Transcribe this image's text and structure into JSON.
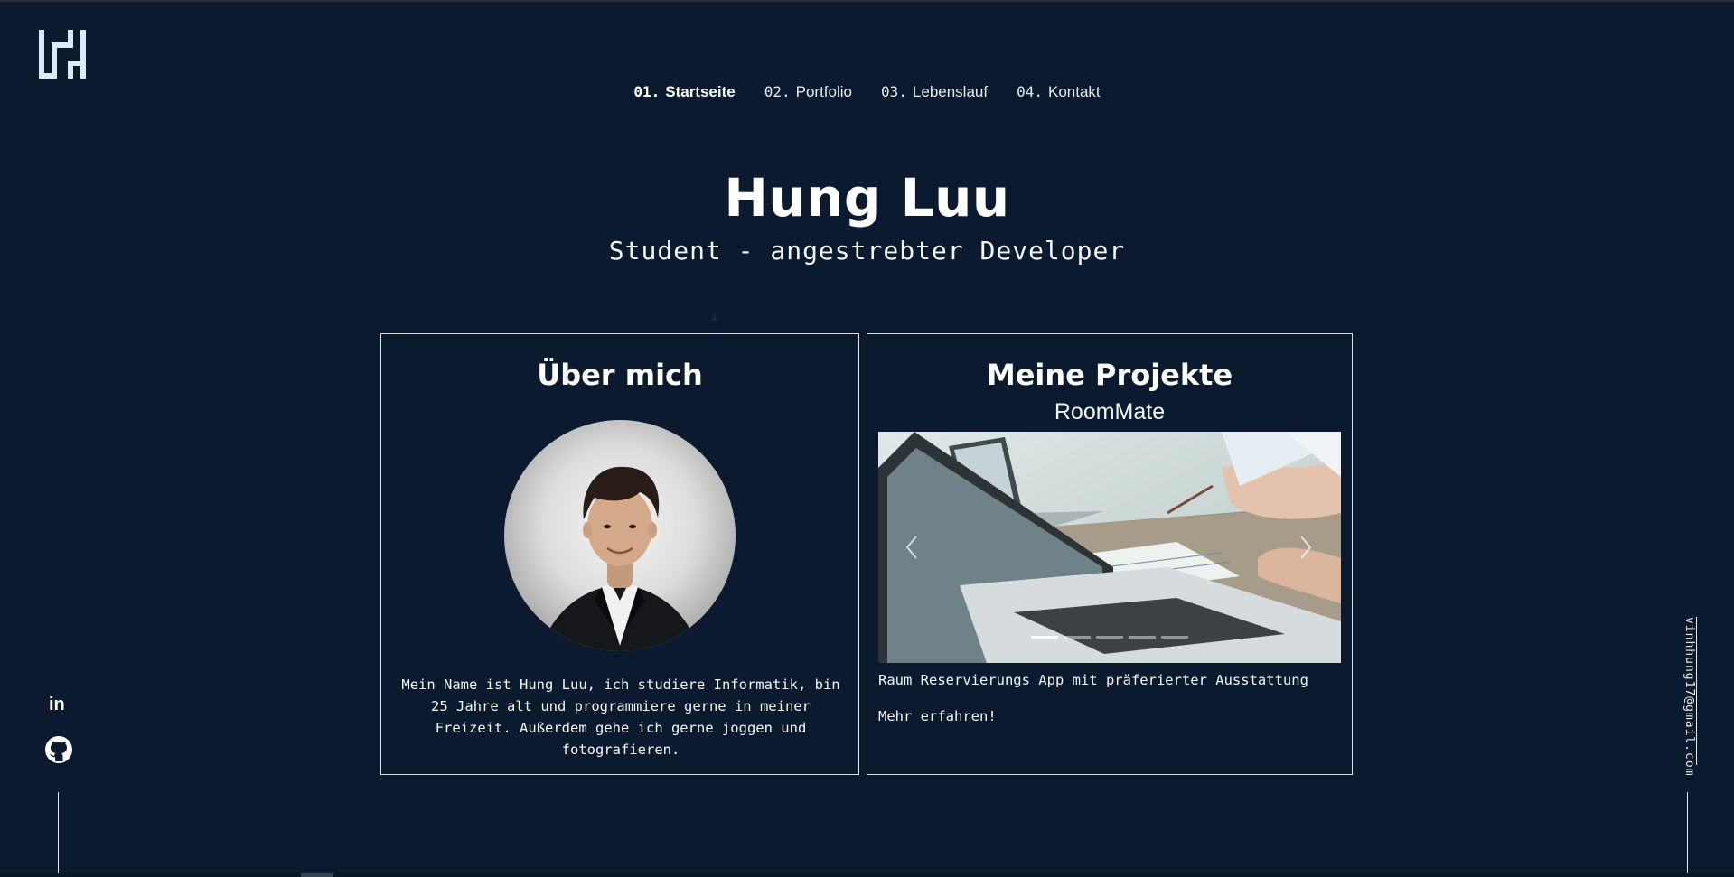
{
  "nav": {
    "items": [
      {
        "num": "01.",
        "label": "Startseite",
        "active": true
      },
      {
        "num": "02.",
        "label": "Portfolio"
      },
      {
        "num": "03.",
        "label": "Lebenslauf"
      },
      {
        "num": "04.",
        "label": "Kontakt"
      }
    ]
  },
  "hero": {
    "name": "Hung Luu",
    "subtitle": "Student - angestrebter Developer"
  },
  "about": {
    "title": "Über mich",
    "text": "Mein Name ist Hung Luu, ich studiere Informatik, bin 25 Jahre alt und programmiere gerne in meiner Freizeit. Außerdem gehe ich gerne joggen und fotografieren."
  },
  "projects": {
    "title": "Meine Projekte",
    "project_name": "RoomMate",
    "description": "Raum Reservierungs App mit präferierter Ausstattung",
    "more_label": "Mehr erfahren!",
    "carousel": {
      "slides": 5,
      "active_index": 0
    }
  },
  "social": {
    "linkedin_label": "in",
    "github_icon": "github-icon"
  },
  "contact": {
    "email": "vinhhung17@gmail.com"
  },
  "colors": {
    "background": "#0b1a2f",
    "text": "#ffffff",
    "border": "#d8dde4"
  }
}
